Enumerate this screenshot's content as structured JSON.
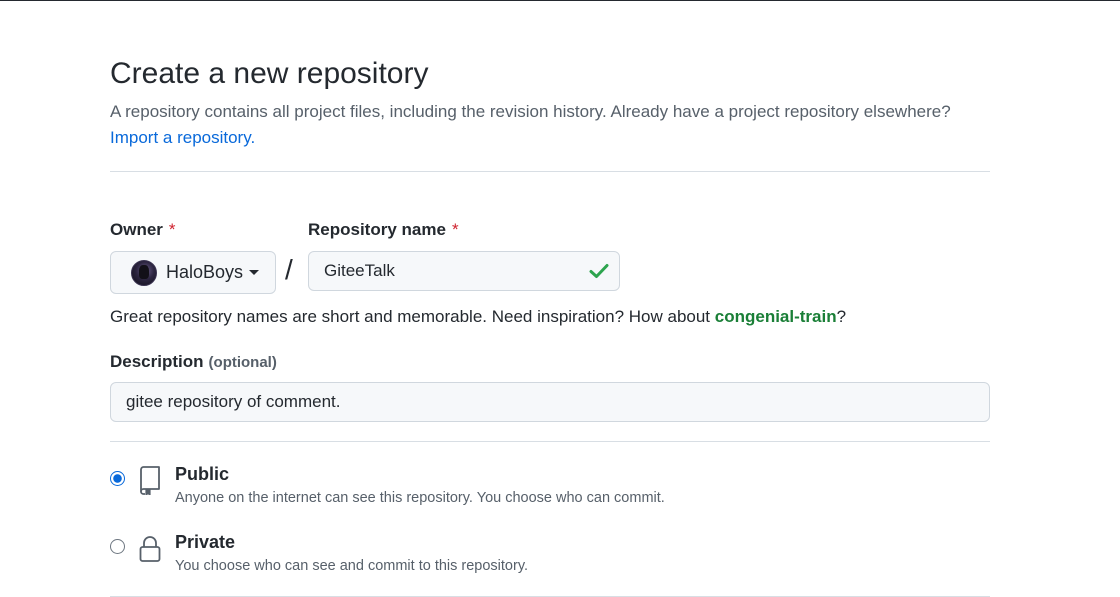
{
  "page": {
    "title": "Create a new repository",
    "subtitle": "A repository contains all project files, including the revision history. Already have a project repository elsewhere?",
    "import_link": "Import a repository."
  },
  "owner": {
    "label": "Owner",
    "required_mark": "*",
    "value": "HaloBoys",
    "avatar_icon": "avatar"
  },
  "separator": "/",
  "repository": {
    "label": "Repository name",
    "required_mark": "*",
    "value": "GiteeTalk",
    "status_icon": "check-icon",
    "status_color": "#2da44e"
  },
  "hint": {
    "prefix": "Great repository names are short and memorable. Need inspiration? How about ",
    "suggestion": "congenial-train",
    "suffix": "?"
  },
  "description": {
    "label": "Description",
    "optional_label": "(optional)",
    "value": "gitee repository of comment."
  },
  "visibility": {
    "selected": "Public",
    "options": [
      {
        "title": "Public",
        "description": "Anyone on the internet can see this repository. You choose who can commit.",
        "icon": "repo-icon",
        "checked": true
      },
      {
        "title": "Private",
        "description": "You choose who can see and commit to this repository.",
        "icon": "lock-icon",
        "checked": false
      }
    ]
  },
  "colors": {
    "link": "#0969da",
    "suggestion": "#1a7f37",
    "required": "#cf222e",
    "radio_selected": "#0969da"
  }
}
